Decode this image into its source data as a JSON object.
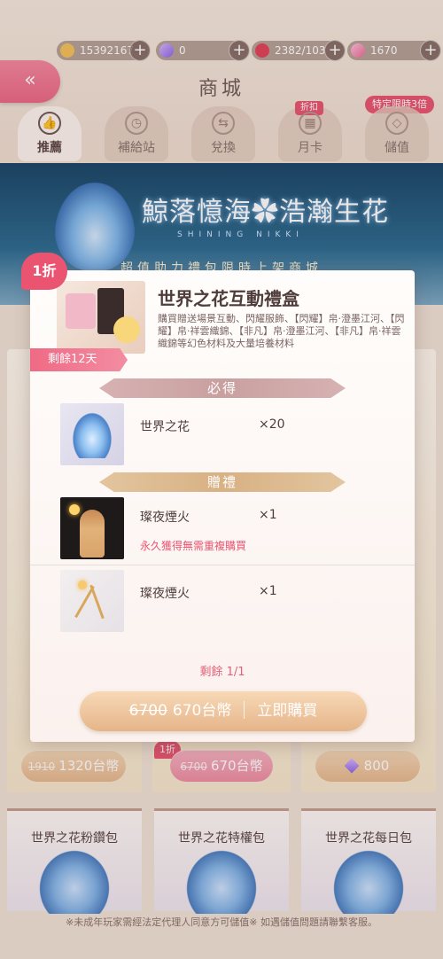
{
  "currency": {
    "coins": "15392167",
    "diamonds": "0",
    "stamina": "2382/103",
    "crystals": "1670"
  },
  "header": {
    "title": "商城",
    "back_icon": "double-chevron-left-icon",
    "limited_badge": "特定限時3倍"
  },
  "tabs": [
    {
      "label": "推薦",
      "icon": "thumbs-up-icon",
      "active": true
    },
    {
      "label": "補給站",
      "icon": "clock-icon"
    },
    {
      "label": "兌換",
      "icon": "exchange-icon"
    },
    {
      "label": "月卡",
      "icon": "calendar-icon",
      "badge": "折扣"
    },
    {
      "label": "儲值",
      "icon": "diamond-icon"
    }
  ],
  "banner": {
    "title": "鯨落憶海✿浩瀚生花",
    "subtitle": "SHINING NIKKI",
    "strip": "超值助力禮包限時上架商城"
  },
  "background_cards": {
    "price1": {
      "old": "1910",
      "new": "1320台幣"
    },
    "price2": {
      "badge": "1折",
      "old": "6700",
      "new": "670台幣"
    },
    "price3": {
      "value": "800"
    },
    "bottom": [
      {
        "title": "世界之花粉鑽包"
      },
      {
        "title": "世界之花特權包"
      },
      {
        "title": "世界之花每日包"
      }
    ]
  },
  "footer_note": "※未成年玩家需經法定代理人同意方可儲值※ 如遇儲值問題請聯繫客服。",
  "modal": {
    "discount": "1折",
    "remaining_days": "剩餘12天",
    "title": "世界之花互動禮盒",
    "description": "購買贈送場景互動、閃耀服飾、【閃耀】帛·澄墨江河、【閃耀】帛·祥雲織錦、【非凡】帛·澄墨江河、【非凡】帛·祥雲織錦等幻色材料及大量培養材料",
    "must_header": "必得",
    "must_items": [
      {
        "name": "世界之花",
        "qty": "×20"
      }
    ],
    "gift_header": "贈禮",
    "gift_items": [
      {
        "name": "璨夜煙火",
        "qty": "×1",
        "note": "永久獲得無需重複購買"
      },
      {
        "name": "璨夜煙火",
        "qty": "×1"
      }
    ],
    "remaining": "剩餘 1/1",
    "buy": {
      "old_price": "6700",
      "price": "670台幣",
      "action": "立即購買"
    }
  }
}
